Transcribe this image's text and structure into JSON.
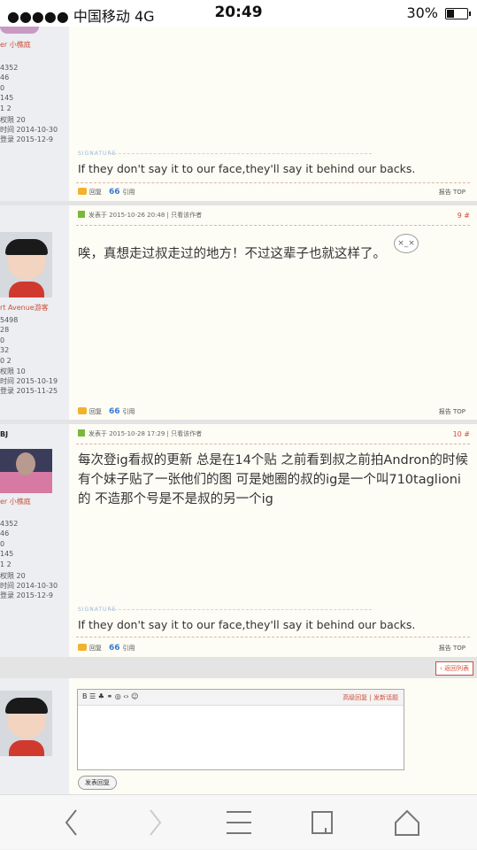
{
  "status": {
    "carrier": "●●●●● 中国移动 4G",
    "time": "20:49",
    "battery": "30%"
  },
  "p0": {
    "username": "er 小樵庭",
    "stats": "4352\n46\n0\n145\n1 2",
    "perm": "权限 20",
    "reg": "时间 2014-10-30",
    "login": "登录 2015-12-9",
    "sig_label": "SIGNATURE",
    "signature": "If they don't say it to our face,they'll say it behind our backs.",
    "reply": "回复",
    "quote": "引用",
    "report": "报告",
    "top": "TOP"
  },
  "p9": {
    "meta": "发表于 2015-10-26 20:48 | 只看该作者",
    "floor": "9 #",
    "username": "rt Avenue游客",
    "stats": "5498\n28\n0\n32\n0 2",
    "perm": "权限 10",
    "reg": "时间 2015-10-19",
    "login": "登录 2015-11-25",
    "text": "唉，真想走过叔走过的地方！不过这辈子也就这样了。",
    "reply": "回复",
    "quote": "引用",
    "report": "报告",
    "top": "TOP"
  },
  "p10": {
    "short": "BJ",
    "meta": "发表于 2015-10-28 17:29 | 只看该作者",
    "floor": "10 #",
    "username": "er 小樵庭",
    "stats": "4352\n46\n0\n145\n1 2",
    "perm": "权限 20",
    "reg": "时间 2014-10-30",
    "login": "登录 2015-12-9",
    "text": "每次登ig看叔的更新 总是在14个贴  之前看到叔之前拍Andron的时候有个妹子贴了一张他们的图 可是她圈的叔的ig是一个叫710taglioni的  不造那个号是不是叔的另一个ig",
    "sig_label": "SIGNATURE",
    "signature": "If they don't say it to our face,they'll say it behind our backs.",
    "reply": "回复",
    "quote": "引用",
    "report": "报告",
    "top": "TOP"
  },
  "back": "‹ 返回列表",
  "editor": {
    "tools": "B ☰ ♣ ⚭ ◎ ‹› ☺",
    "adv": "高级回复",
    "newtopic": "发新话题",
    "submit": "发表回复"
  }
}
